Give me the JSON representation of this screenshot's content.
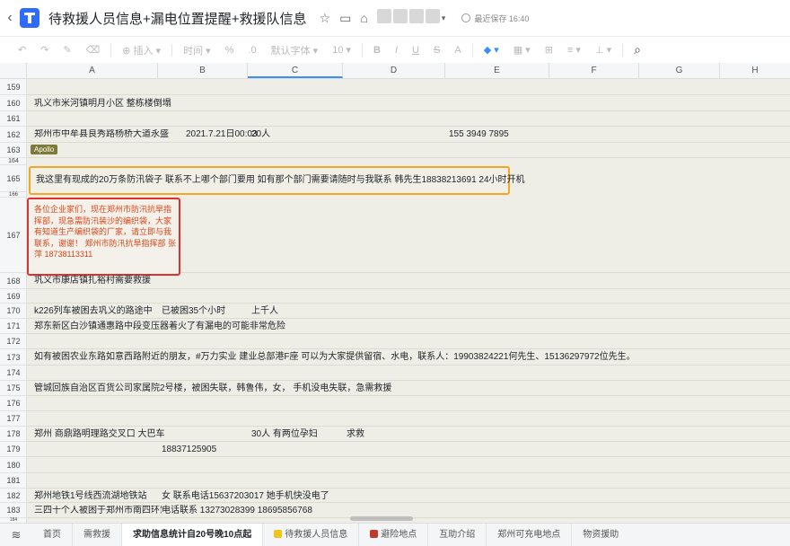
{
  "titlebar": {
    "back_glyph": "‹",
    "title": "待救援人员信息+漏电位置提醒+救援队信息",
    "saved_text": "最近保存 16:40",
    "icons": [
      "star-icon",
      "doc-info-icon",
      "share-icon",
      "users-avatar-icon"
    ]
  },
  "toolbar": {
    "insert_label": "插入",
    "time_label": "时间",
    "font_label": "默认字体",
    "size_label": "10",
    "bold": "B",
    "italic": "I",
    "underline": "U",
    "strike": "S"
  },
  "columns": [
    "A",
    "B",
    "C",
    "D",
    "E",
    "F",
    "G",
    "H"
  ],
  "rows": [
    "159",
    "160",
    "161",
    "162",
    "163",
    "164",
    "165",
    "166",
    "167",
    "168",
    "169",
    "170",
    "171",
    "172",
    "173",
    "174",
    "175",
    "176",
    "177",
    "178",
    "179",
    "180",
    "181",
    "182",
    "183",
    "184"
  ],
  "cells": {
    "r160a": "巩义市米河镇明月小区 整栋楼倒塌",
    "r162a": "郑州市中牟县良秀路杨桥大道永盛",
    "r162b": "2021.7.21日00:03",
    "r162c": "20人",
    "r162e": "155 3949 7895",
    "r163tag": "Apollo",
    "r165a": "我这里有现成的20万条防汛袋子 联系不上哪个部门要用 如有那个部门需要请随时与我联系 韩先生18838213691 24小时开机",
    "r167a": "各位企业家们，现在郑州市防汛抗旱指挥部，现急需防汛装沙的编织袋，大家有知道生产编织袋的厂家，请立即与我联系，谢谢！ 郑州市防汛抗旱指挥部 张萍 18738113311",
    "r168a": "巩义市康店镇扎裕村需要救援",
    "r170a": "k226列车被困去巩义的路途中",
    "r170b": "已被困35个小时",
    "r170c": "上千人",
    "r171a": "郑东新区白沙镇通惠路中段变压器着火了有漏电的可能非常危险",
    "r173a": "如有被困农业东路如意西路附近的朋友，#万力实业 建业总部港F座 可以为大家提供留宿、水电，联系人：19903824221何先生、15136297972位先生。",
    "r175a": "管城回族自治区百货公司家属院2号楼，被困失联，韩鲁伟，女， 手机没电失联，急需救援",
    "r178a": "郑州 商鼎路明理路交叉口 大巴车",
    "r178c": "30人 有两位孕妇",
    "r178d": "求救",
    "r179b": "18837125905",
    "r182a": "郑州地铁1号线西流湖地铁站",
    "r182b": "女  联系电话15637203017   她手机快没电了",
    "r183a": "三四十个人被困于郑州市南四环紫",
    "r183b": "电话联系 13273028399   18695856768"
  },
  "tabs": [
    {
      "label": "首页",
      "active": false
    },
    {
      "label": "需救援",
      "active": false
    },
    {
      "label": "求助信息统计自20号晚10点起",
      "active": true
    },
    {
      "label": "待救援人员信息",
      "active": false,
      "sticker": "#f0c419"
    },
    {
      "label": "避险地点",
      "active": false,
      "sticker": "#c0392b"
    },
    {
      "label": "互助介绍",
      "active": false
    },
    {
      "label": "郑州可充电地点",
      "active": false
    },
    {
      "label": "物资援助",
      "active": false
    }
  ],
  "colors": {
    "highlight_orange": "#f5a623",
    "highlight_red": "#e03131",
    "red_text": "#d9461a",
    "sheet_bg": "#eeede6",
    "accent": "#2f6bff"
  }
}
